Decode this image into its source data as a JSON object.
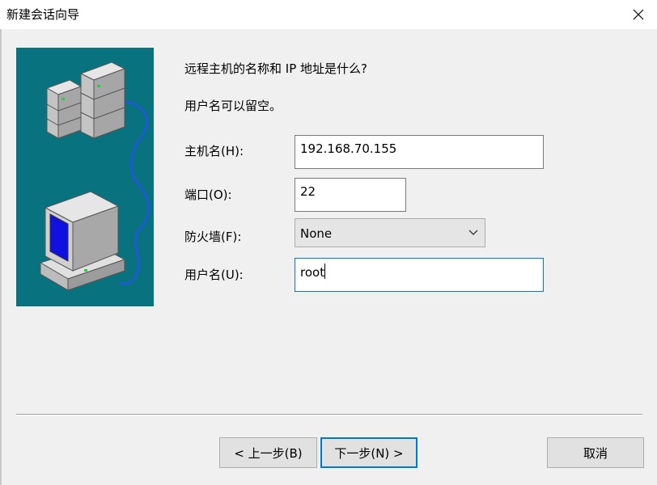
{
  "window": {
    "title": "新建会话向导"
  },
  "prompt": {
    "question": "远程主机的名称和 IP 地址是什么?",
    "hint": "用户名可以留空。"
  },
  "form": {
    "hostname": {
      "label": "主机名(H):",
      "value": "192.168.70.155"
    },
    "port": {
      "label": "端口(O):",
      "value": "22"
    },
    "firewall": {
      "label": "防火墙(F):",
      "selected": "None"
    },
    "username": {
      "label": "用户名(U):",
      "value": "root"
    }
  },
  "buttons": {
    "back": "< 上一步(B)",
    "next": "下一步(N) >",
    "cancel": "取消"
  },
  "colors": {
    "illustration_bg": "#08737e",
    "focus_border": "#0078d7",
    "monitor_screen": "#1010e0",
    "cable": "#1e5ad2"
  },
  "icons": {
    "close": "close-icon",
    "dropdown": "chevron-down-icon",
    "illustration": "network-computers-illustration"
  }
}
